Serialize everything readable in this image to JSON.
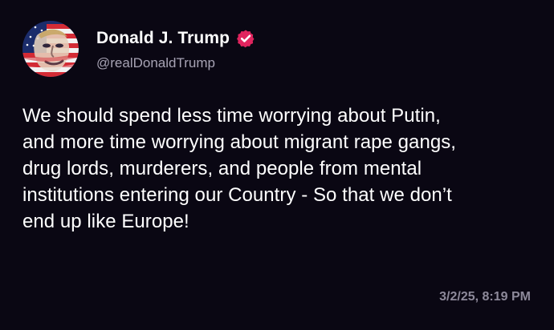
{
  "post": {
    "author": {
      "display_name": "Donald J. Trump",
      "handle": "@realDonaldTrump",
      "verified": true,
      "verified_icon": "verified-badge-icon",
      "avatar_icon": "profile-avatar"
    },
    "text": "We should spend less time worrying about Putin,\nand more time worrying about migrant rape gangs,\ndrug lords, murderers, and people from mental\ninstitutions entering our Country - So that we don’t\nend up like Europe!",
    "timestamp": "3/2/25, 8:19 PM"
  },
  "colors": {
    "background": "#0a0713",
    "text": "#ffffff",
    "handle": "#a7a3b4",
    "timestamp": "#8d899a",
    "verified": "#e0245e"
  }
}
